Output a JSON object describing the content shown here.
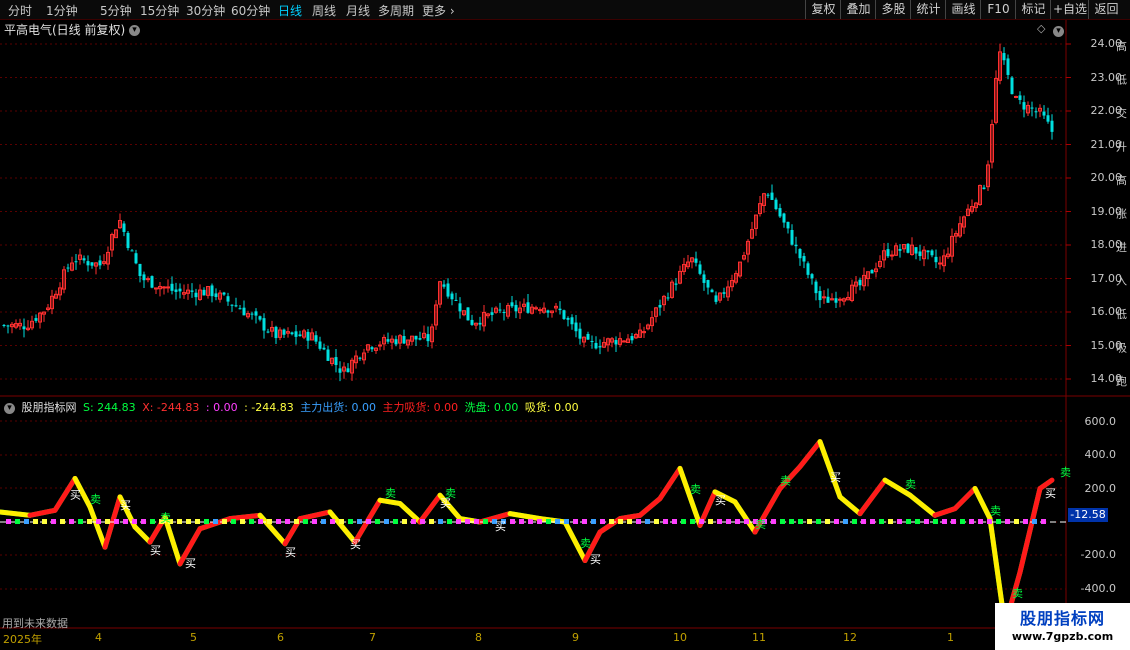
{
  "periods": [
    {
      "label": "分时"
    },
    {
      "label": "1分钟"
    },
    {
      "label": "5分钟"
    },
    {
      "label": "15分钟"
    },
    {
      "label": "30分钟"
    },
    {
      "label": "60分钟"
    },
    {
      "label": "日线"
    },
    {
      "label": "周线"
    },
    {
      "label": "月线"
    },
    {
      "label": "多周期"
    },
    {
      "label": "更多"
    }
  ],
  "active_period": "日线",
  "toolbar": [
    {
      "label": "复权"
    },
    {
      "label": "叠加"
    },
    {
      "label": "多股"
    },
    {
      "label": "统计"
    },
    {
      "label": "画线"
    },
    {
      "label": "F10"
    },
    {
      "label": "标记"
    },
    {
      "label": "+自选"
    },
    {
      "label": "返回"
    }
  ],
  "main_title": "平高电气(日线 前复权)",
  "price_axis": [
    "24.00",
    "23.00",
    "22.00",
    "21.00",
    "20.00",
    "19.00",
    "18.00",
    "17.00",
    "16.00",
    "15.00",
    "14.00"
  ],
  "indicator": {
    "name": "股朋指标网",
    "fields": [
      {
        "text": "S: 244.83",
        "color": "#00ff40"
      },
      {
        "text": "X: -244.83",
        "color": "#ff3030"
      },
      {
        "text": ": 0.00",
        "color": "#ff40ff"
      },
      {
        "text": ": -244.83",
        "color": "#ffff40"
      },
      {
        "text": "主力出货: 0.00",
        "color": "#3aa0ff"
      },
      {
        "text": "主力吸货: 0.00",
        "color": "#ff2020"
      },
      {
        "text": "洗盘: 0.00",
        "color": "#00ff40"
      },
      {
        "text": "吸货: 0.00",
        "color": "#ffff40"
      }
    ],
    "axis": [
      "600.0",
      "400.0",
      "200.0",
      "-200.0",
      "-400.0"
    ],
    "current_value": "-12.58"
  },
  "future_note": "用到未来数据",
  "x_axis": [
    "2025年",
    "4",
    "5",
    "6",
    "7",
    "8",
    "9",
    "10",
    "11",
    "12",
    "1"
  ],
  "buy_label": "买",
  "sell_label": "卖",
  "side_tags": [
    "高",
    "低",
    "交",
    "升",
    "高",
    "涨",
    "进",
    "入",
    "低",
    "吸",
    "跑",
    "走",
    "票",
    "加",
    "货",
    "洗",
    "控",
    "盘",
    "底",
    "出",
    "仓",
    "股"
  ],
  "watermark": {
    "title": "股朋指标网",
    "url": "www.7gpzb.com"
  },
  "colors": {
    "up": "#ff3030",
    "down": "#00e0e0",
    "grid": "#5a0000"
  }
}
